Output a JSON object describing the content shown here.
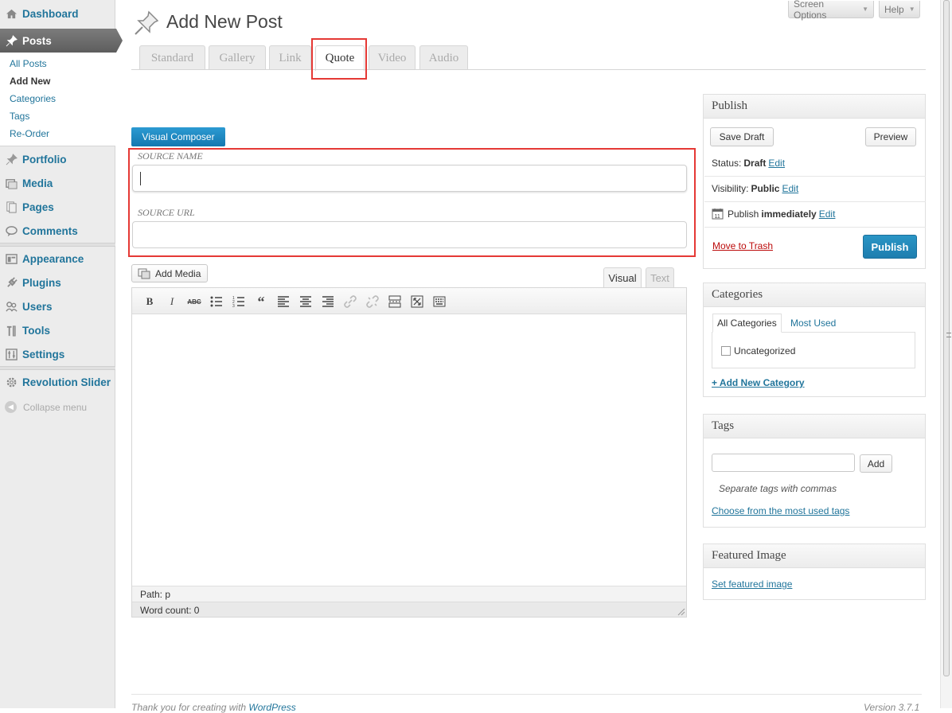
{
  "sidebar": {
    "dashboard": "Dashboard",
    "posts": "Posts",
    "submenu": [
      "All Posts",
      "Add New",
      "Categories",
      "Tags",
      "Re-Order"
    ],
    "portfolio": "Portfolio",
    "media": "Media",
    "pages": "Pages",
    "comments": "Comments",
    "appearance": "Appearance",
    "plugins": "Plugins",
    "users": "Users",
    "tools": "Tools",
    "settings": "Settings",
    "revolution": "Revolution Slider",
    "collapse": "Collapse menu"
  },
  "top": {
    "screen_options": "Screen Options",
    "help": "Help"
  },
  "page": {
    "title": "Add New Post"
  },
  "format_tabs": [
    "Standard",
    "Gallery",
    "Link",
    "Quote",
    "Video",
    "Audio"
  ],
  "quote": {
    "visual_composer": "Visual Composer",
    "source_name_label": "SOURCE NAME",
    "source_name_value": "",
    "source_url_label": "SOURCE URL",
    "source_url_value": ""
  },
  "editor": {
    "add_media": "Add Media",
    "tab_visual": "Visual",
    "tab_text": "Text",
    "path": "Path: p",
    "word_count": "Word count: 0"
  },
  "publish": {
    "title": "Publish",
    "save_draft": "Save Draft",
    "preview": "Preview",
    "status_label": "Status:",
    "status_value": "Draft",
    "visibility_label": "Visibility:",
    "visibility_value": "Public",
    "publish_label": "Publish",
    "publish_value": "immediately",
    "edit": "Edit",
    "trash": "Move to Trash",
    "publish_button": "Publish"
  },
  "categories": {
    "title": "Categories",
    "tab_all": "All Categories",
    "tab_used": "Most Used",
    "item": "Uncategorized",
    "add_new": "+ Add New Category"
  },
  "tags": {
    "title": "Tags",
    "input_value": "",
    "add": "Add",
    "hint": "Separate tags with commas",
    "choose": "Choose from the most used tags"
  },
  "featured": {
    "title": "Featured Image",
    "set": "Set featured image"
  },
  "footer": {
    "thanks": "Thank you for creating with ",
    "wp": "WordPress",
    "version": "Version 3.7.1"
  },
  "colors": {
    "link": "#21759b",
    "primary": "#1e7eaf",
    "highlight": "#e53935",
    "trash": "#bc0b0b"
  }
}
